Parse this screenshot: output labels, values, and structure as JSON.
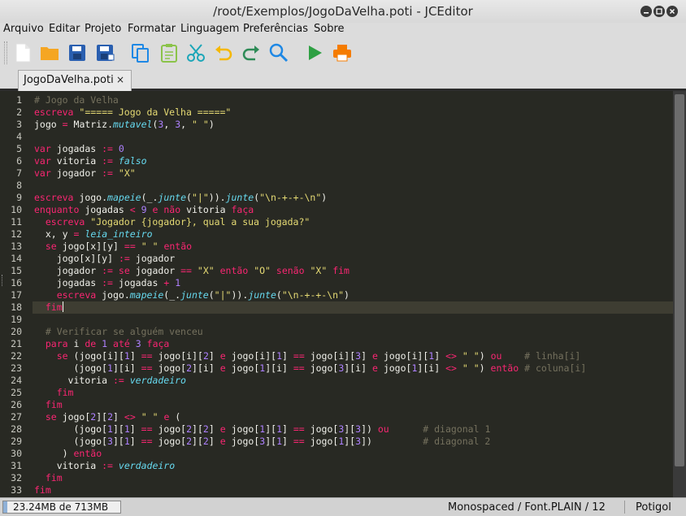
{
  "window": {
    "title": "/root/Exemplos/JogoDaVelha.poti - JCEditor"
  },
  "menu": {
    "items": [
      "Arquivo",
      "Editar",
      "Projeto",
      "Formatar",
      "Linguagem",
      "Preferências",
      "Sobre"
    ]
  },
  "toolbar": {
    "icons": [
      "new-file-icon",
      "open-folder-icon",
      "save-icon",
      "save-as-icon",
      "copy-icon",
      "paste-icon",
      "cut-icon",
      "undo-icon",
      "redo-icon",
      "search-icon",
      "run-icon",
      "print-icon"
    ],
    "colors": {
      "file": "#ffffff",
      "folder": "#f5a623",
      "save": "#2a5fb0",
      "copy": "#1e88e5",
      "paste": "#8bc34a",
      "cut": "#1ba6b8",
      "undo": "#f5b800",
      "redo": "#2e8b57",
      "search": "#1e88e5",
      "run": "#2ea043",
      "print": "#f57c00"
    }
  },
  "tabs": [
    {
      "label": "JogoDaVelha.poti",
      "close": "×",
      "active": true
    }
  ],
  "editor": {
    "theme": {
      "background": "#282923",
      "keyword": "#f92672",
      "function": "#66d9ef",
      "string": "#e6db74",
      "number": "#ae81ff",
      "comment": "#75715e"
    },
    "current_line": 18,
    "lines": [
      "# Jogo da Velha",
      "escreva \"===== Jogo da Velha =====\"",
      "jogo = Matriz.mutavel(3, 3, \" \")",
      "",
      "var jogadas := 0",
      "var vitoria := falso",
      "var jogador := \"X\"",
      "",
      "escreva jogo.mapeie(_.junte(\"|\")).junte(\"\\n-+-+-\\n\")",
      "enquanto jogadas < 9 e não vitoria faça",
      "  escreva \"Jogador {jogador}, qual a sua jogada?\"",
      "  x, y = leia_inteiro",
      "  se jogo[x][y] == \" \" então",
      "    jogo[x][y] := jogador",
      "    jogador := se jogador == \"X\" então \"O\" senão \"X\" fim",
      "    jogadas := jogadas + 1",
      "    escreva jogo.mapeie(_.junte(\"|\")).junte(\"\\n-+-+-\\n\")",
      "  fim",
      "",
      "  # Verificar se alguém venceu",
      "  para i de 1 até 3 faça",
      "    se (jogo[i][1] == jogo[i][2] e jogo[i][1] == jogo[i][3] e jogo[i][1] <> \" \") ou    # linha[i]",
      "       (jogo[1][i] == jogo[2][i] e jogo[1][i] == jogo[3][i] e jogo[1][i] <> \" \") então # coluna[i]",
      "      vitoria := verdadeiro",
      "    fim",
      "  fim",
      "  se jogo[2][2] <> \" \" e (",
      "       (jogo[1][1] == jogo[2][2] e jogo[1][1] == jogo[3][3]) ou      # diagonal 1",
      "       (jogo[3][1] == jogo[2][2] e jogo[3][1] == jogo[1][3])         # diagonal 2",
      "     ) então",
      "    vitoria := verdadeiro",
      "  fim",
      "fim"
    ]
  },
  "status": {
    "memory": "23.24MB de 713MB",
    "memory_fraction": 0.0326,
    "font": "Monospaced / Font.PLAIN / 12",
    "language": "Potigol"
  }
}
